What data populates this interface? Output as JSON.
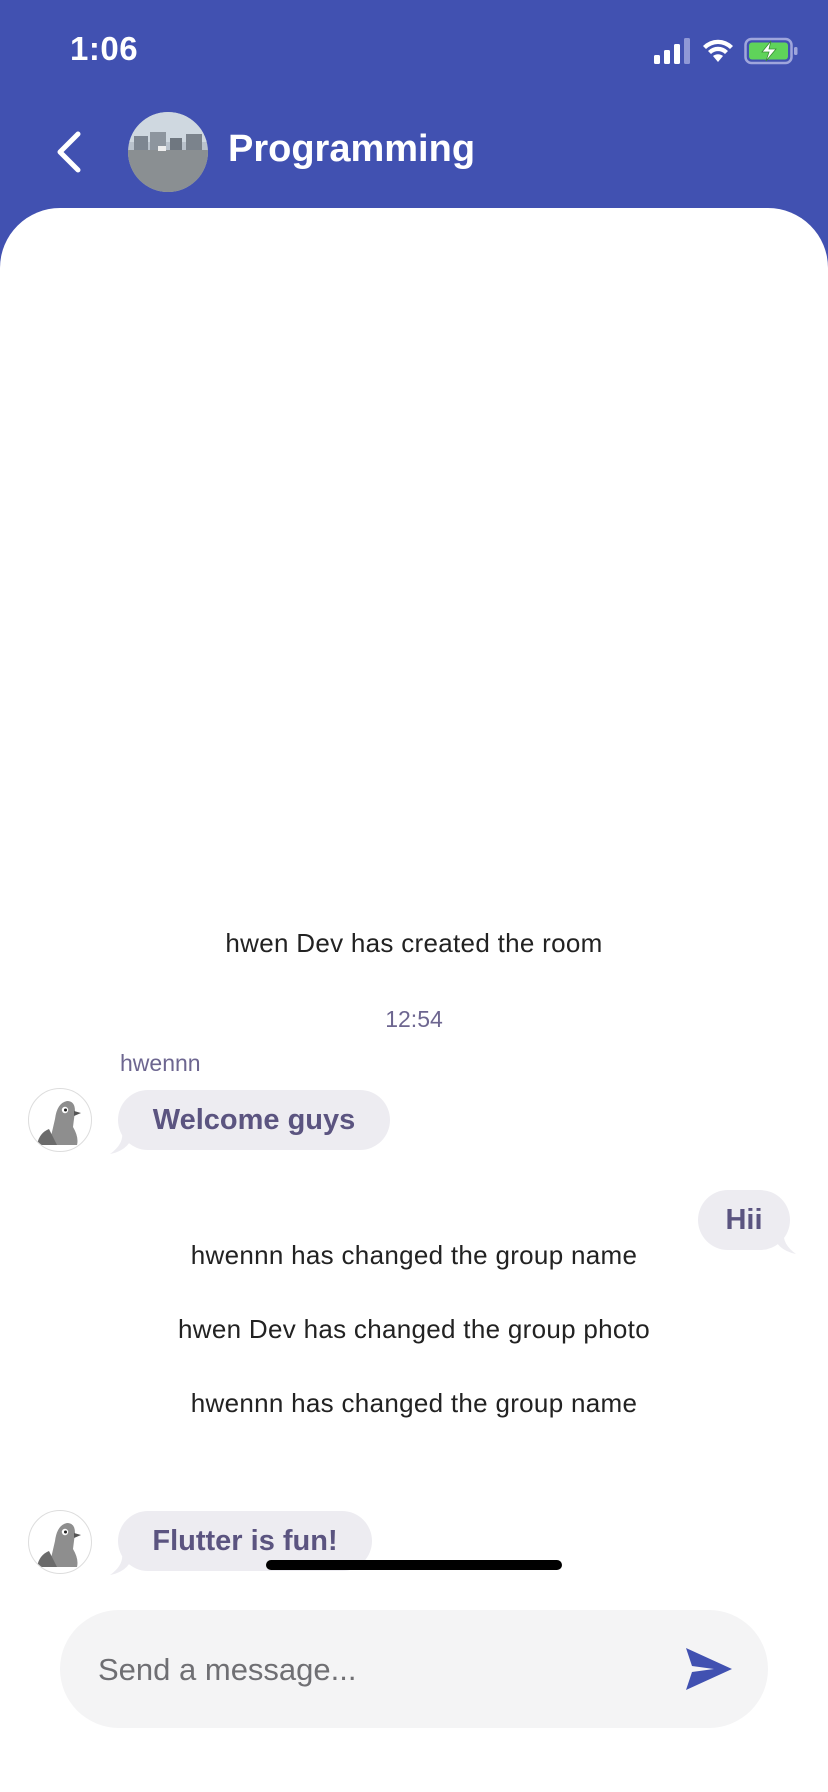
{
  "status_bar": {
    "time": "1:06"
  },
  "header": {
    "title": "Programming",
    "back_icon": "chevron-left-icon",
    "avatar": "group-photo"
  },
  "messages": {
    "system_1": "hwen Dev has created the room",
    "time_1": "12:54",
    "sender_1": "hwennn",
    "bubble_1": "Welcome guys",
    "bubble_2": "Hii",
    "system_2": "hwennn has changed the group name",
    "system_3": "hwen Dev has changed the group photo",
    "system_4": "hwennn has changed the group name",
    "bubble_3": "Flutter is fun!"
  },
  "composer": {
    "placeholder": "Send a message...",
    "send_icon": "send-icon"
  },
  "colors": {
    "primary": "#4151b1",
    "bubble_bg": "#edecf1",
    "bubble_text": "#5b5480",
    "input_bg": "#f4f4f5"
  }
}
